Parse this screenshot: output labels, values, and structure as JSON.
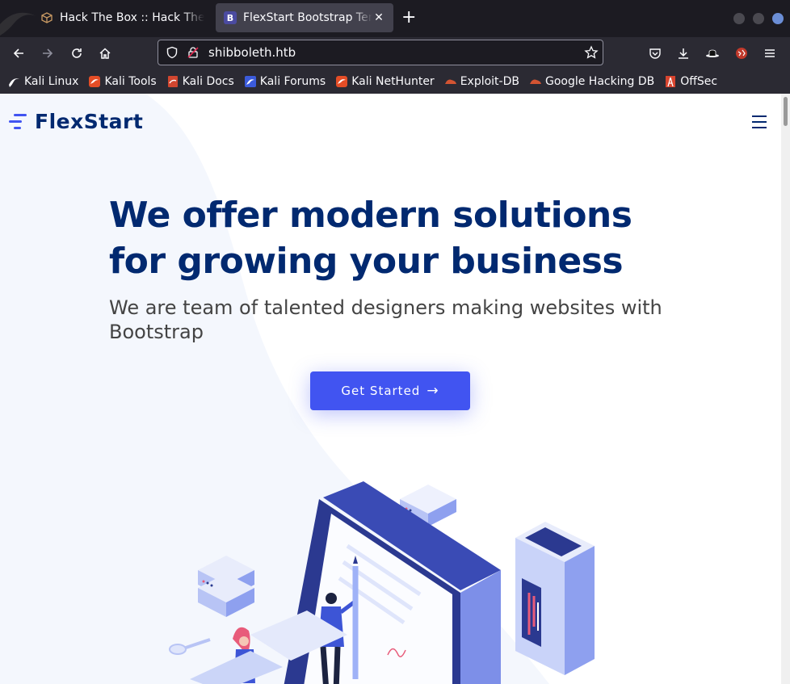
{
  "browser": {
    "tabs": [
      {
        "title": "Hack The Box :: Hack The Box",
        "active": false,
        "favicon": "htb-cube-icon"
      },
      {
        "title": "FlexStart Bootstrap Template",
        "active": true,
        "favicon": "bootstrap-b-icon",
        "favicon_letter": "B"
      }
    ],
    "url": "shibboleth.htb",
    "bookmarks": [
      {
        "label": "Kali Linux",
        "icon": "kali-dragon-icon"
      },
      {
        "label": "Kali Tools",
        "icon": "kali-tools-icon"
      },
      {
        "label": "Kali Docs",
        "icon": "kali-docs-icon"
      },
      {
        "label": "Kali Forums",
        "icon": "kali-forums-icon"
      },
      {
        "label": "Kali NetHunter",
        "icon": "kali-nethunter-icon"
      },
      {
        "label": "Exploit-DB",
        "icon": "exploit-db-icon"
      },
      {
        "label": "Google Hacking DB",
        "icon": "ghdb-icon"
      },
      {
        "label": "OffSec",
        "icon": "offsec-icon"
      }
    ]
  },
  "site": {
    "logo_text": "FlexStart",
    "hero": {
      "title": "We offer modern solutions for growing your business",
      "subtitle": "We are team of talented designers making websites with Bootstrap",
      "cta_label": "Get Started",
      "cta_arrow": "→"
    }
  },
  "colors": {
    "primary": "#4154f1",
    "heading": "#012970",
    "body_text": "#444444",
    "browser_dark": "#1c1b22",
    "toolbar": "#2b2a33"
  }
}
